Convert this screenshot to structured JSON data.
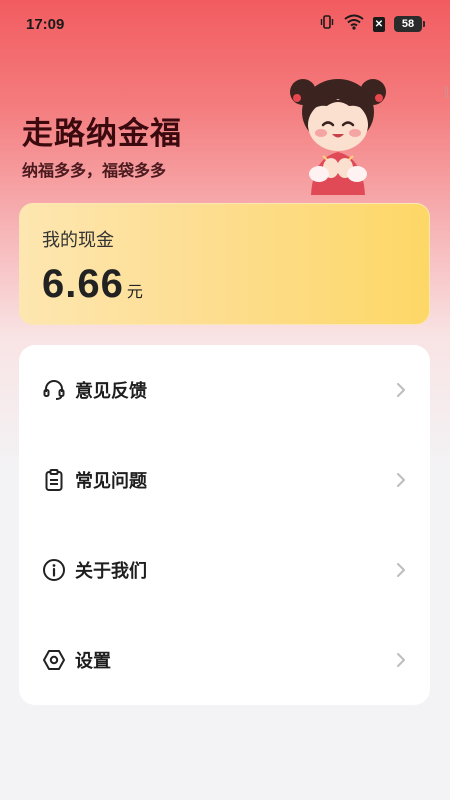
{
  "status_bar": {
    "time": "17:09",
    "battery": "58",
    "icons": [
      "vibrate-icon",
      "wifi-icon",
      "sim-off-icon",
      "battery-icon"
    ]
  },
  "header": {
    "title": "走路纳金福",
    "subtitle": "纳福多多，福袋多多"
  },
  "cash_card": {
    "label": "我的现金",
    "amount": "6.66",
    "unit": "元"
  },
  "menu": {
    "items": [
      {
        "label": "意见反馈",
        "icon": "headset-icon"
      },
      {
        "label": "常见问题",
        "icon": "clipboard-icon"
      },
      {
        "label": "关于我们",
        "icon": "info-icon"
      },
      {
        "label": "设置",
        "icon": "settings-hex-icon"
      }
    ]
  },
  "colors": {
    "header_gradient_top": "#f25c60",
    "card_gold": "#fddc8a",
    "background": "#f3f3f5"
  }
}
